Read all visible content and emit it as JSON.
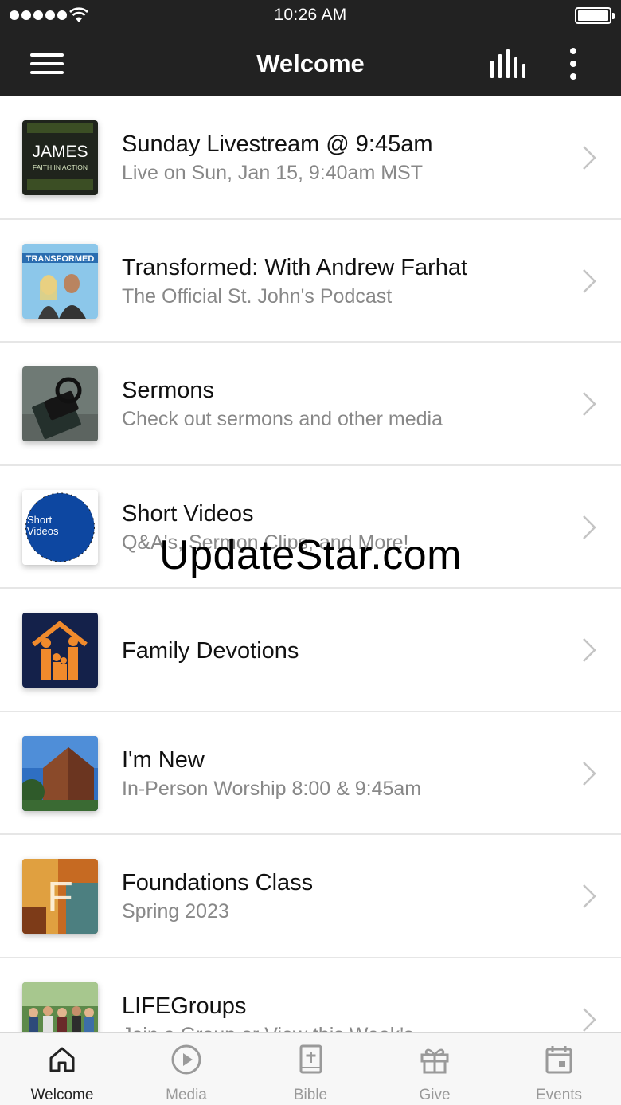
{
  "status_bar": {
    "time": "10:26 AM"
  },
  "nav": {
    "title": "Welcome"
  },
  "list": [
    {
      "title": "Sunday Livestream @ 9:45am",
      "subtitle": "Live on Sun, Jan 15, 9:40am MST",
      "thumb_text": [
        "JAMES",
        "FAITH IN ACTION"
      ]
    },
    {
      "title": "Transformed: With Andrew Farhat",
      "subtitle": "The Official St. John's Podcast",
      "thumb_text": [
        "TRANSFORMED"
      ]
    },
    {
      "title": "Sermons",
      "subtitle": "Check out sermons and other media"
    },
    {
      "title": "Short Videos",
      "subtitle": "Q&A's, Sermon Clips, and More!",
      "thumb_text": [
        "Short",
        "Videos"
      ]
    },
    {
      "title": "Family Devotions",
      "subtitle": ""
    },
    {
      "title": "I'm New",
      "subtitle": "In-Person Worship 8:00 & 9:45am"
    },
    {
      "title": "Foundations Class",
      "subtitle": "Spring 2023",
      "thumb_text": [
        "F"
      ]
    },
    {
      "title": "LIFEGroups",
      "subtitle": "Join a Group or View this Week's"
    }
  ],
  "watermark": "UpdateStar.com",
  "tabs": [
    {
      "label": "Welcome",
      "icon": "home-icon",
      "active": true
    },
    {
      "label": "Media",
      "icon": "play-circle-icon",
      "active": false
    },
    {
      "label": "Bible",
      "icon": "bible-icon",
      "active": false
    },
    {
      "label": "Give",
      "icon": "gift-icon",
      "active": false
    },
    {
      "label": "Events",
      "icon": "calendar-icon",
      "active": false
    }
  ],
  "colors": {
    "bar": "#222222",
    "title": "#111111",
    "subtitle": "#888888",
    "tab_inactive": "#999999",
    "tab_active": "#222222"
  }
}
